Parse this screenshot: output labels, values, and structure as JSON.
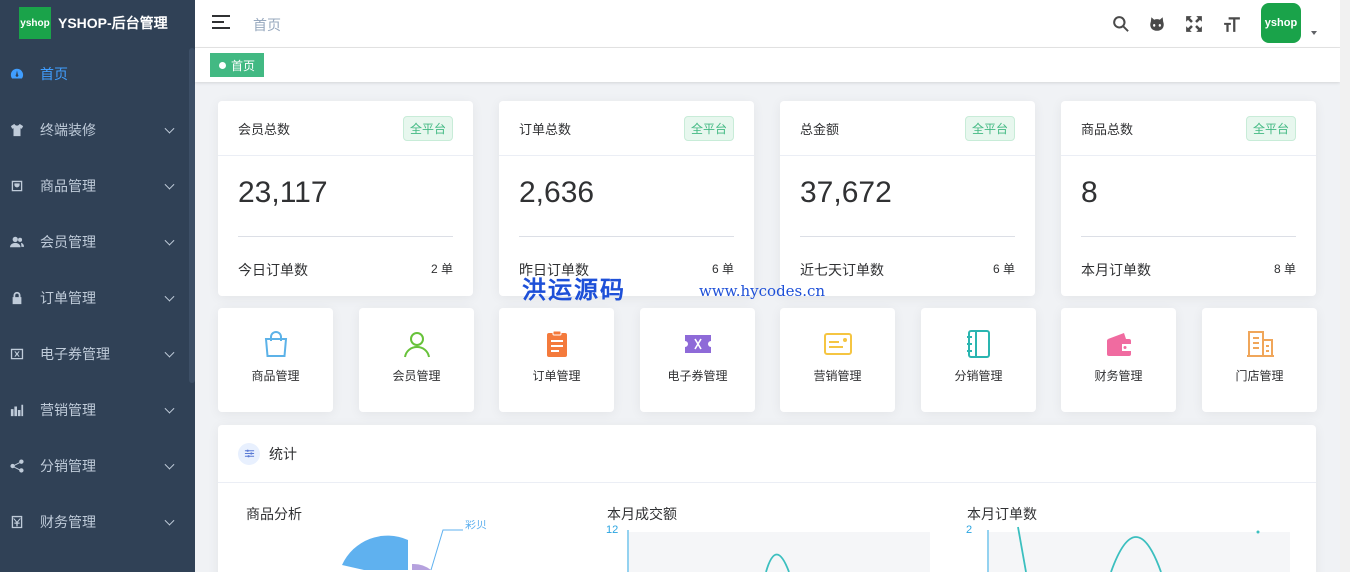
{
  "app": {
    "logo_text": "yshop",
    "title": "YSHOP-后台管理"
  },
  "sidebar": {
    "items": [
      {
        "label": "首页",
        "icon": "dashboard-icon",
        "active": true
      },
      {
        "label": "终端装修",
        "icon": "shirt-icon"
      },
      {
        "label": "商品管理",
        "icon": "product-icon"
      },
      {
        "label": "会员管理",
        "icon": "peoples-icon"
      },
      {
        "label": "订单管理",
        "icon": "lock-icon"
      },
      {
        "label": "电子券管理",
        "icon": "coupon-icon"
      },
      {
        "label": "营销管理",
        "icon": "chart-icon"
      },
      {
        "label": "分销管理",
        "icon": "share-icon"
      },
      {
        "label": "财务管理",
        "icon": "money-icon"
      }
    ]
  },
  "navbar": {
    "breadcrumb": "首页",
    "avatar_text": "yshop"
  },
  "tags": {
    "active": "首页"
  },
  "stat_cards": [
    {
      "title": "会员总数",
      "tag": "全平台",
      "value": "23,117",
      "foot_label": "今日订单数",
      "foot_value": "2 单"
    },
    {
      "title": "订单总数",
      "tag": "全平台",
      "value": "2,636",
      "foot_label": "昨日订单数",
      "foot_value": "6 单"
    },
    {
      "title": "总金额",
      "tag": "全平台",
      "value": "37,672",
      "foot_label": "近七天订单数",
      "foot_value": "6 单"
    },
    {
      "title": "商品总数",
      "tag": "全平台",
      "value": "8",
      "foot_label": "本月订单数",
      "foot_value": "8 单"
    }
  ],
  "quick_entries": [
    {
      "label": "商品管理",
      "icon": "shopping-bag-icon",
      "color": "#5cb2e8"
    },
    {
      "label": "会员管理",
      "icon": "user-icon",
      "color": "#67c23a"
    },
    {
      "label": "订单管理",
      "icon": "clipboard-icon",
      "color": "#f47a3c"
    },
    {
      "label": "电子券管理",
      "icon": "ticket-icon",
      "color": "#8e6ad8"
    },
    {
      "label": "营销管理",
      "icon": "card-icon",
      "color": "#f5c542"
    },
    {
      "label": "分销管理",
      "icon": "notebook-icon",
      "color": "#2ab5b0"
    },
    {
      "label": "财务管理",
      "icon": "wallet-icon",
      "color": "#f06ba0"
    },
    {
      "label": "门店管理",
      "icon": "building-icon",
      "color": "#f0a65a"
    }
  ],
  "statistics": {
    "title": "统计",
    "charts": [
      {
        "title": "商品分析",
        "label": "彩贝"
      },
      {
        "title": "本月成交额",
        "ytick": "12"
      },
      {
        "title": "本月订单数",
        "ytick": "2"
      }
    ]
  },
  "watermark": {
    "cn": "洪运源码",
    "url": "www.hycodes.cn"
  }
}
